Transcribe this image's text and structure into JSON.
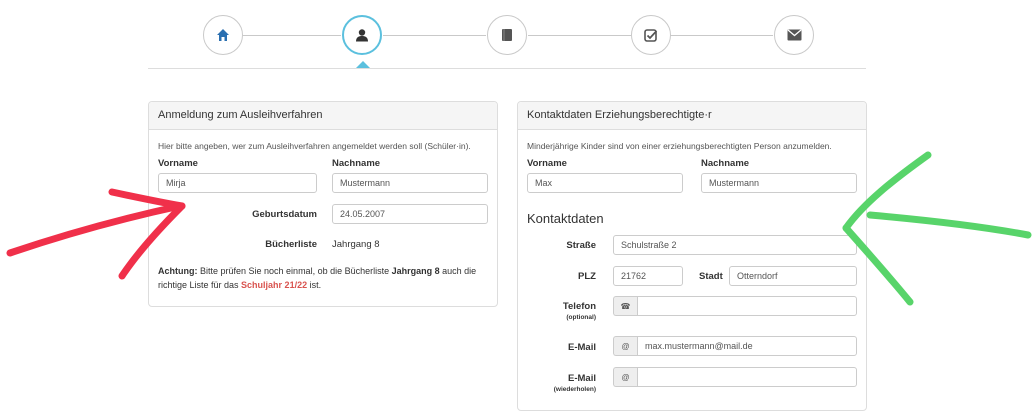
{
  "wizard": {
    "steps": [
      {
        "icon": "home-icon",
        "active": false
      },
      {
        "icon": "user-icon",
        "active": true
      },
      {
        "icon": "book-icon",
        "active": false
      },
      {
        "icon": "checkbox-icon",
        "active": false
      },
      {
        "icon": "envelope-icon",
        "active": false
      }
    ],
    "accent_color": "#5bc0de"
  },
  "left_panel": {
    "title": "Anmeldung zum Ausleihverfahren",
    "hint": "Hier bitte angeben, wer zum Ausleihverfahren angemeldet werden soll (Schüler·in).",
    "vorname_label": "Vorname",
    "vorname_value": "Mirja",
    "nachname_label": "Nachname",
    "nachname_value": "Mustermann",
    "geburtsdatum_label": "Geburtsdatum",
    "geburtsdatum_value": "24.05.2007",
    "buecherliste_label": "Bücherliste",
    "buecherliste_value": "Jahrgang 8",
    "notice": {
      "prefix": "Achtung:",
      "text1": " Bitte prüfen Sie noch einmal, ob die Bücherliste ",
      "jahrgang": "Jahrgang 8",
      "text2": " auch die",
      "text3": "richtige Liste für das ",
      "schuljahr": "Schuljahr 21/22",
      "text4": " ist."
    }
  },
  "right_panel": {
    "title": "Kontaktdaten Erziehungsberechtigte·r",
    "hint": "Minderjährige Kinder sind von einer erziehungsberechtigten Person anzumelden.",
    "vorname_label": "Vorname",
    "vorname_value": "Max",
    "nachname_label": "Nachname",
    "nachname_value": "Mustermann",
    "section_title": "Kontaktdaten",
    "strasse_label": "Straße",
    "strasse_value": "Schulstraße 2",
    "plz_label": "PLZ",
    "plz_value": "21762",
    "stadt_label": "Stadt",
    "stadt_value": "Otterndorf",
    "telefon_label": "Telefon",
    "telefon_sub": "(optional)",
    "telefon_value": "",
    "email_label": "E-Mail",
    "email_value": "max.mustermann@mail.de",
    "email2_label": "E-Mail",
    "email2_sub": "(wiederholen)",
    "email2_value": "",
    "at_symbol": "@",
    "phone_symbol": "☎"
  },
  "annotations": {
    "left_arrow_color": "#f0304a",
    "right_arrow_color": "#58d46a"
  }
}
